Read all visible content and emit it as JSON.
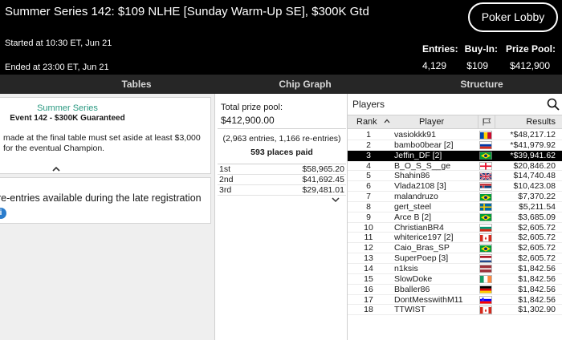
{
  "header": {
    "title": "Summer Series 142: $109 NLHE [Sunday Warm-Up SE], $300K Gtd",
    "lobby_button": "Poker Lobby",
    "started": "Started at 10:30 ET, Jun 21",
    "ended": "Ended at 23:00 ET, Jun 21",
    "stats": {
      "entries_label": "Entries:",
      "entries_value": "4,129",
      "buyin_label": "Buy-In:",
      "buyin_value": "$109",
      "prizepool_label": "Prize Pool:",
      "prizepool_value": "$412,900"
    }
  },
  "tabs": [
    "Tables",
    "Chip Graph",
    "Structure"
  ],
  "info": {
    "series_name": "Summer Series",
    "event_name": "Event 142 - $300K Guaranteed",
    "note": "made at the final table must set aside at least $3,000 for the eventual Champion.",
    "reentry_text": "re-entries available during the late registration"
  },
  "prizes": {
    "pool_label": "Total prize pool:",
    "pool_value": "$412,900.00",
    "entries_note": "(2,963 entries, 1,166 re-entries)",
    "places_paid": "593 places paid",
    "payouts": [
      {
        "place": "1st",
        "amount": "$58,965.20"
      },
      {
        "place": "2nd",
        "amount": "$41,692.45"
      },
      {
        "place": "3rd",
        "amount": "$29,481.01"
      }
    ]
  },
  "players": {
    "title": "Players",
    "columns": {
      "rank": "Rank",
      "player": "Player",
      "results": "Results"
    },
    "rows": [
      {
        "rank": "1",
        "name": "vasiokkk91",
        "flag": "moldova",
        "result": "*$48,217.12"
      },
      {
        "rank": "2",
        "name": "bambo0bear [2]",
        "flag": "russia",
        "result": "*$41,979.92"
      },
      {
        "rank": "3",
        "name": "Jeffin_DF [2]",
        "flag": "brazil",
        "result": "*$39,941.62"
      },
      {
        "rank": "4",
        "name": "B_O_S_S__ge",
        "flag": "georgia",
        "result": "$20,846.20"
      },
      {
        "rank": "5",
        "name": "Shahin86",
        "flag": "uk",
        "result": "$14,740.48"
      },
      {
        "rank": "6",
        "name": "Vlada2108 [3]",
        "flag": "serbia",
        "result": "$10,423.08"
      },
      {
        "rank": "7",
        "name": "malandruzo",
        "flag": "brazil",
        "result": "$7,370.22"
      },
      {
        "rank": "8",
        "name": "gert_steel",
        "flag": "sweden",
        "result": "$5,211.54"
      },
      {
        "rank": "9",
        "name": "Arce B [2]",
        "flag": "brazil",
        "result": "$3,685.09"
      },
      {
        "rank": "10",
        "name": "ChristianBR4",
        "flag": "bulgaria",
        "result": "$2,605.72"
      },
      {
        "rank": "11",
        "name": "whiterice197 [2]",
        "flag": "canada",
        "result": "$2,605.72"
      },
      {
        "rank": "12",
        "name": "Caio_Bras_SP",
        "flag": "brazil",
        "result": "$2,605.72"
      },
      {
        "rank": "13",
        "name": "SuperPoep [3]",
        "flag": "netherlands",
        "result": "$2,605.72"
      },
      {
        "rank": "14",
        "name": "n1ksis",
        "flag": "latvia",
        "result": "$1,842.56"
      },
      {
        "rank": "15",
        "name": "SlowDoke",
        "flag": "ireland",
        "result": "$1,842.56"
      },
      {
        "rank": "16",
        "name": "Bballer86",
        "flag": "germany",
        "result": "$1,842.56"
      },
      {
        "rank": "17",
        "name": "DontMesswithM11",
        "flag": "slovenia",
        "result": "$1,842.56"
      },
      {
        "rank": "18",
        "name": "TTWIST",
        "flag": "canada",
        "result": "$1,302.90"
      }
    ]
  }
}
